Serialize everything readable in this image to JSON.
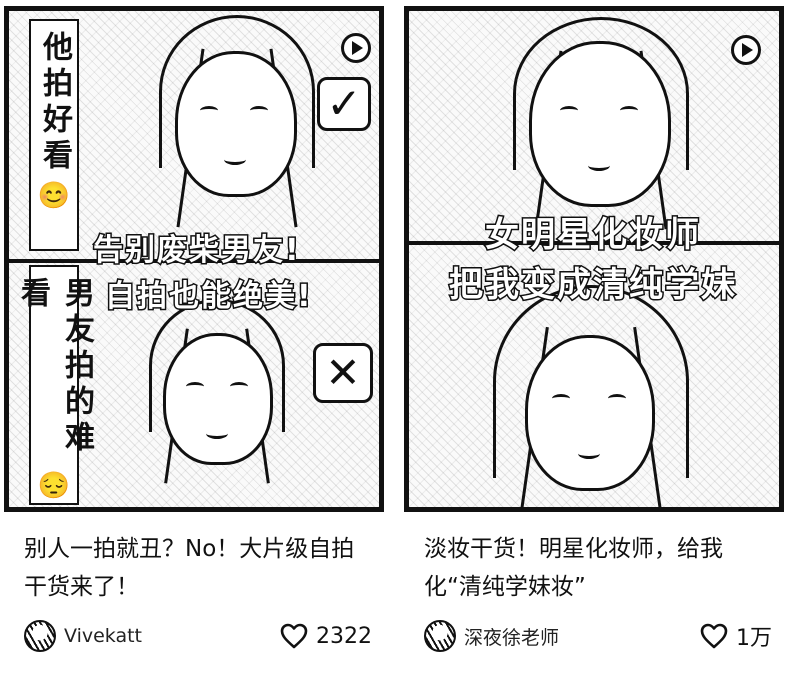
{
  "feed": {
    "cards": [
      {
        "overlay": {
          "top_vertical": "他拍好看",
          "top_emoji": "😊",
          "banner_line1": "告别废柴男友!",
          "banner_line2": "自拍也能绝美!",
          "bottom_vertical": "男友拍的难看",
          "bottom_emoji": "😔",
          "check_mark": "✓",
          "cross_mark": "✕"
        },
        "title": "别人一拍就丑？No！大片级自拍干货来了！",
        "author": "Vivekatt",
        "likes": "2322"
      },
      {
        "overlay": {
          "banner_line1": "女明星化妆师",
          "banner_line2": "把我变成清纯学妹"
        },
        "title": "淡妆干货！明星化妆师，给我化“清纯学妹妆”",
        "author": "深夜徐老师",
        "likes": "1万"
      }
    ]
  },
  "icons": {
    "play": "play-icon",
    "heart": "heart-outline-icon",
    "check": "checkbox-icon",
    "cross": "cross-box-icon"
  }
}
